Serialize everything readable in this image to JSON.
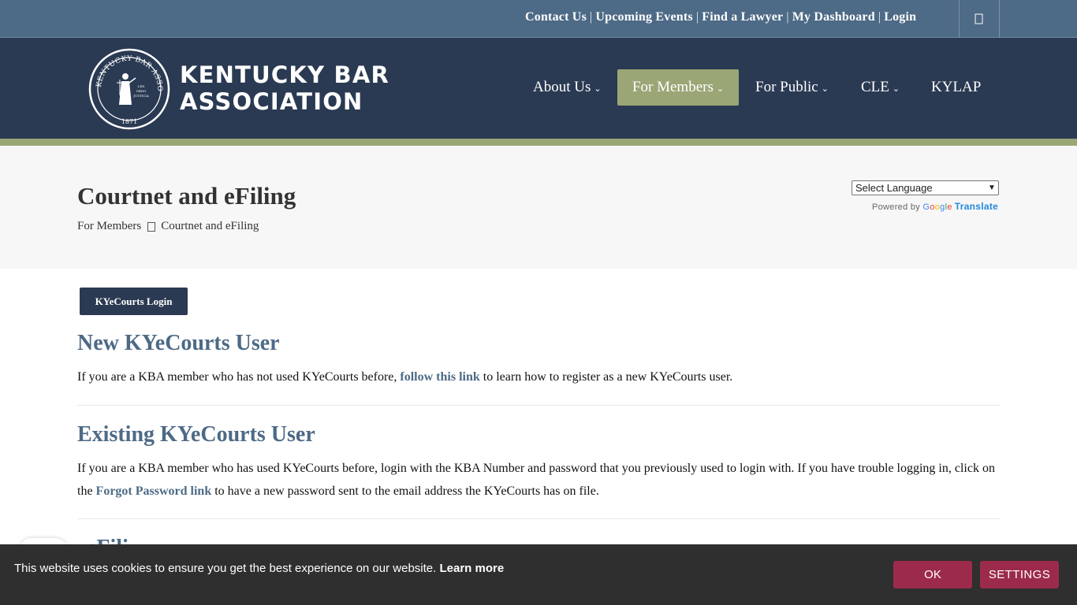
{
  "topbar": {
    "links": [
      "Contact Us",
      "Upcoming Events",
      "Find a Lawyer",
      "My Dashboard",
      "Login"
    ],
    "separator": "|",
    "search_icon": "search-icon"
  },
  "brand": {
    "line1": "KENTUCKY BAR",
    "line2": "ASSOCIATION",
    "seal_text": "KENTUCKY BAR ASSOCIATION 1871",
    "seal_motto": "LEX ORDO JUSTICIA"
  },
  "nav": {
    "items": [
      {
        "label": "About Us",
        "has_dropdown": true
      },
      {
        "label": "For Members",
        "has_dropdown": true,
        "active": true
      },
      {
        "label": "For Public",
        "has_dropdown": true
      },
      {
        "label": "CLE",
        "has_dropdown": true
      },
      {
        "label": "KYLAP",
        "has_dropdown": false
      }
    ]
  },
  "page": {
    "title": "Courtnet and eFiling",
    "breadcrumb": [
      "For Members",
      "Courtnet and eFiling"
    ]
  },
  "translate": {
    "select_label": "Select Language",
    "powered_by": "Powered by",
    "google": "Google",
    "translate_label": "Translate"
  },
  "content": {
    "login_button": "KYeCourts Login",
    "sections": [
      {
        "heading": "New KYeCourts User",
        "text_before": "If you are a KBA member who has not used KYeCourts before, ",
        "link": "follow this link",
        "text_after": " to learn how to register as a new KYeCourts user."
      },
      {
        "heading": "Existing KYeCourts User",
        "text_before": "If you are a KBA member who has used KYeCourts before, login with the KBA Number and password that you previously used to login with. If you have trouble logging in, click on the ",
        "link": "Forgot Password link",
        "text_after": " to have a new password sent to the email address the KYeCourts has on file."
      }
    ],
    "partial_heading": "eFili"
  },
  "cookie": {
    "message": "This website uses cookies to ensure you get the best experience on our website.",
    "learn_more": "Learn more",
    "ok": "OK",
    "settings": "SETTINGS"
  },
  "colors": {
    "topbar": "#4d6a86",
    "header": "#2b3a53",
    "accent": "#9aa676",
    "link": "#4d6a86",
    "cookie_bar": "#2f2f2f",
    "cookie_button": "#9c2b4b"
  }
}
